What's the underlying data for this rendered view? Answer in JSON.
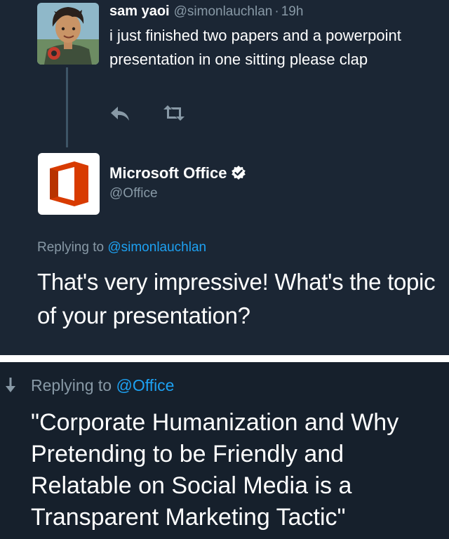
{
  "tweet": {
    "user_name": "sam yaoi",
    "user_handle": "@simonlauchlan",
    "separator": "·",
    "time": "19h",
    "text": "i just finished two papers and a powerpoint presentation in one sitting please clap",
    "avatar_icon": "cartoon-avatar-icon",
    "actions": [
      "reply-icon",
      "retweet-icon"
    ]
  },
  "reply": {
    "user_name": "Microsoft Office",
    "user_handle": "@Office",
    "verified_icon": "verified-badge-icon",
    "avatar_icon": "office-logo-icon",
    "replying_prefix": "Replying to",
    "replying_handle": "@simonlauchlan",
    "text": "That's very impressive! What's the topic of your presentation?"
  },
  "response": {
    "replying_prefix": "Replying to",
    "replying_handle": "@Office",
    "arrow_icon": "down-arrow-icon",
    "text": "\"Corporate Humanization and Why Pretending to be Friendly and Relatable on Social Media is a Transparent Marketing Tactic\""
  },
  "colors": {
    "background": "#1b2634",
    "background_bottom": "#16202c",
    "muted_text": "#8899a6",
    "link": "#1da1f2",
    "office_orange": "#d83b01"
  }
}
